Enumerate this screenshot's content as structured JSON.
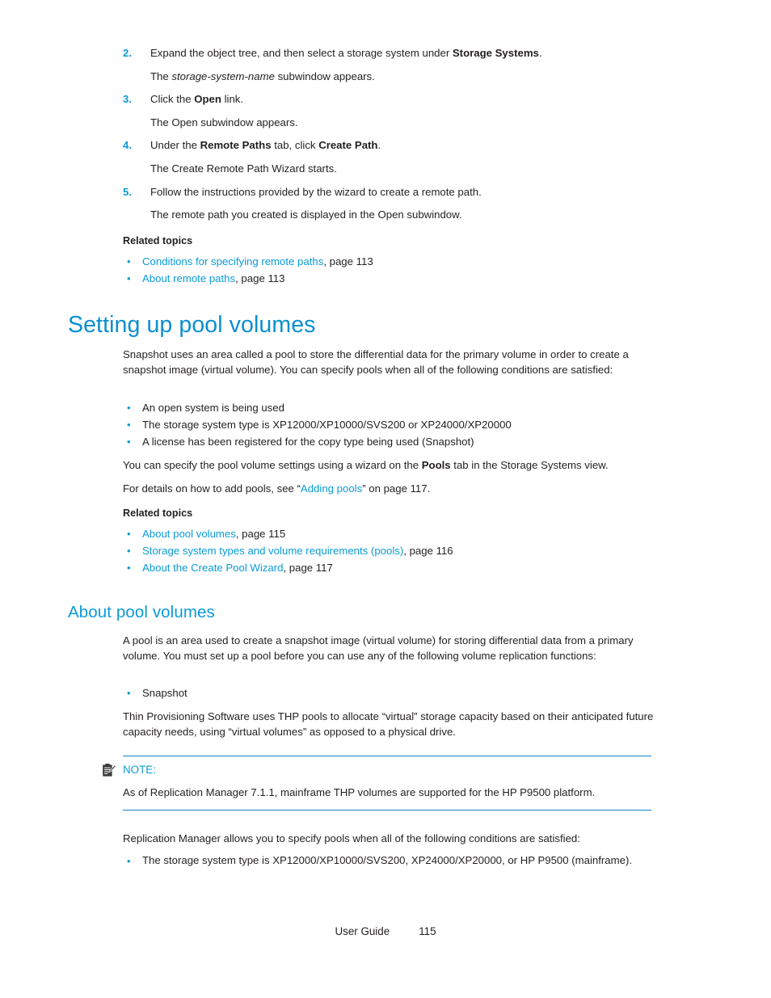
{
  "document": {
    "procedure": {
      "items": [
        {
          "number": "2.",
          "text_parts": [
            "Expand the object tree, and then select a storage system under ",
            "Storage Systems",
            "."
          ],
          "text_plain": "Expand the object tree, and then select a storage system under Storage Systems.",
          "result": "The storage-system-name subwindow appears.",
          "result_italic": "storage-system-name"
        },
        {
          "number": "3.",
          "text_plain": "Click the Open link.",
          "result": "The Open subwindow appears."
        },
        {
          "number": "4.",
          "text_plain": "Under the Remote Paths tab, click Create Path.",
          "result": "The Create Remote Path Wizard starts."
        },
        {
          "number": "5.",
          "text_plain": "Follow the instructions provided by the wizard to create a remote path.",
          "result": "The remote path you created is displayed in the Open subwindow."
        }
      ]
    },
    "related_topics_1": {
      "heading": "Related topics",
      "items": [
        {
          "link": "Conditions for specifying remote paths",
          "page": ", page 113"
        },
        {
          "link": "About remote paths",
          "page": ", page 113"
        }
      ]
    },
    "section_pool_volumes": {
      "heading": "Setting up pool volumes",
      "intro": "Snapshot uses an area called a pool to store the differential data for the primary volume in order to create a snapshot image (virtual volume). You can specify pools when all of the following conditions are satisfied:",
      "conditions": [
        "An open system is being used",
        "The storage system type is XP12000/XP10000/SVS200 or XP24000/XP20000",
        "A license has been registered for the copy type being used (Snapshot)"
      ],
      "wizard_note_pre": "You can specify the pool volume settings using a wizard on the ",
      "wizard_note_bold": "Pools",
      "wizard_note_post": " tab in the Storage Systems view.",
      "details_pre": " For details on how to add pools, see “",
      "details_link": "Adding pools",
      "details_post": "” on page 117."
    },
    "related_topics_2": {
      "heading": "Related topics",
      "items": [
        {
          "link": "About pool volumes",
          "page": ", page 115"
        },
        {
          "link": "Storage system types and volume requirements (pools)",
          "page": ", page 116"
        },
        {
          "link": "About the Create Pool Wizard",
          "page": ", page 117"
        }
      ]
    },
    "section_about_pool_volumes": {
      "heading": "About pool volumes",
      "paragraph_1": "A pool is an area used to create a snapshot image (virtual volume) for storing differential data from a primary volume. You must set up a pool before you can use any of the following volume replication functions:",
      "bullets": [
        "Snapshot"
      ],
      "paragraph_2": "Thin Provisioning Software uses THP pools to allocate “virtual” storage capacity based on their anticipated future capacity needs, using “virtual volumes” as opposed to a physical drive."
    },
    "note": {
      "icon": "note-clipboard-icon",
      "label": "NOTE:",
      "text": "As of Replication Manager 7.1.1, mainframe THP volumes are supported for the HP P9500 platform."
    },
    "closing": {
      "paragraph": "Replication Manager allows you to specify pools when all of the following conditions are satisfied:",
      "bullets": [
        "The storage system type is XP12000/XP10000/SVS200, XP24000/XP20000, or HP P9500 (mainframe)."
      ]
    },
    "footer": {
      "label": "User Guide",
      "page_number": "115"
    },
    "colors": {
      "heading_blue": "#0a8fd0",
      "link_blue": "#0a9bd7",
      "body_black": "#231f20",
      "rule_blue": "#1584c5"
    }
  }
}
